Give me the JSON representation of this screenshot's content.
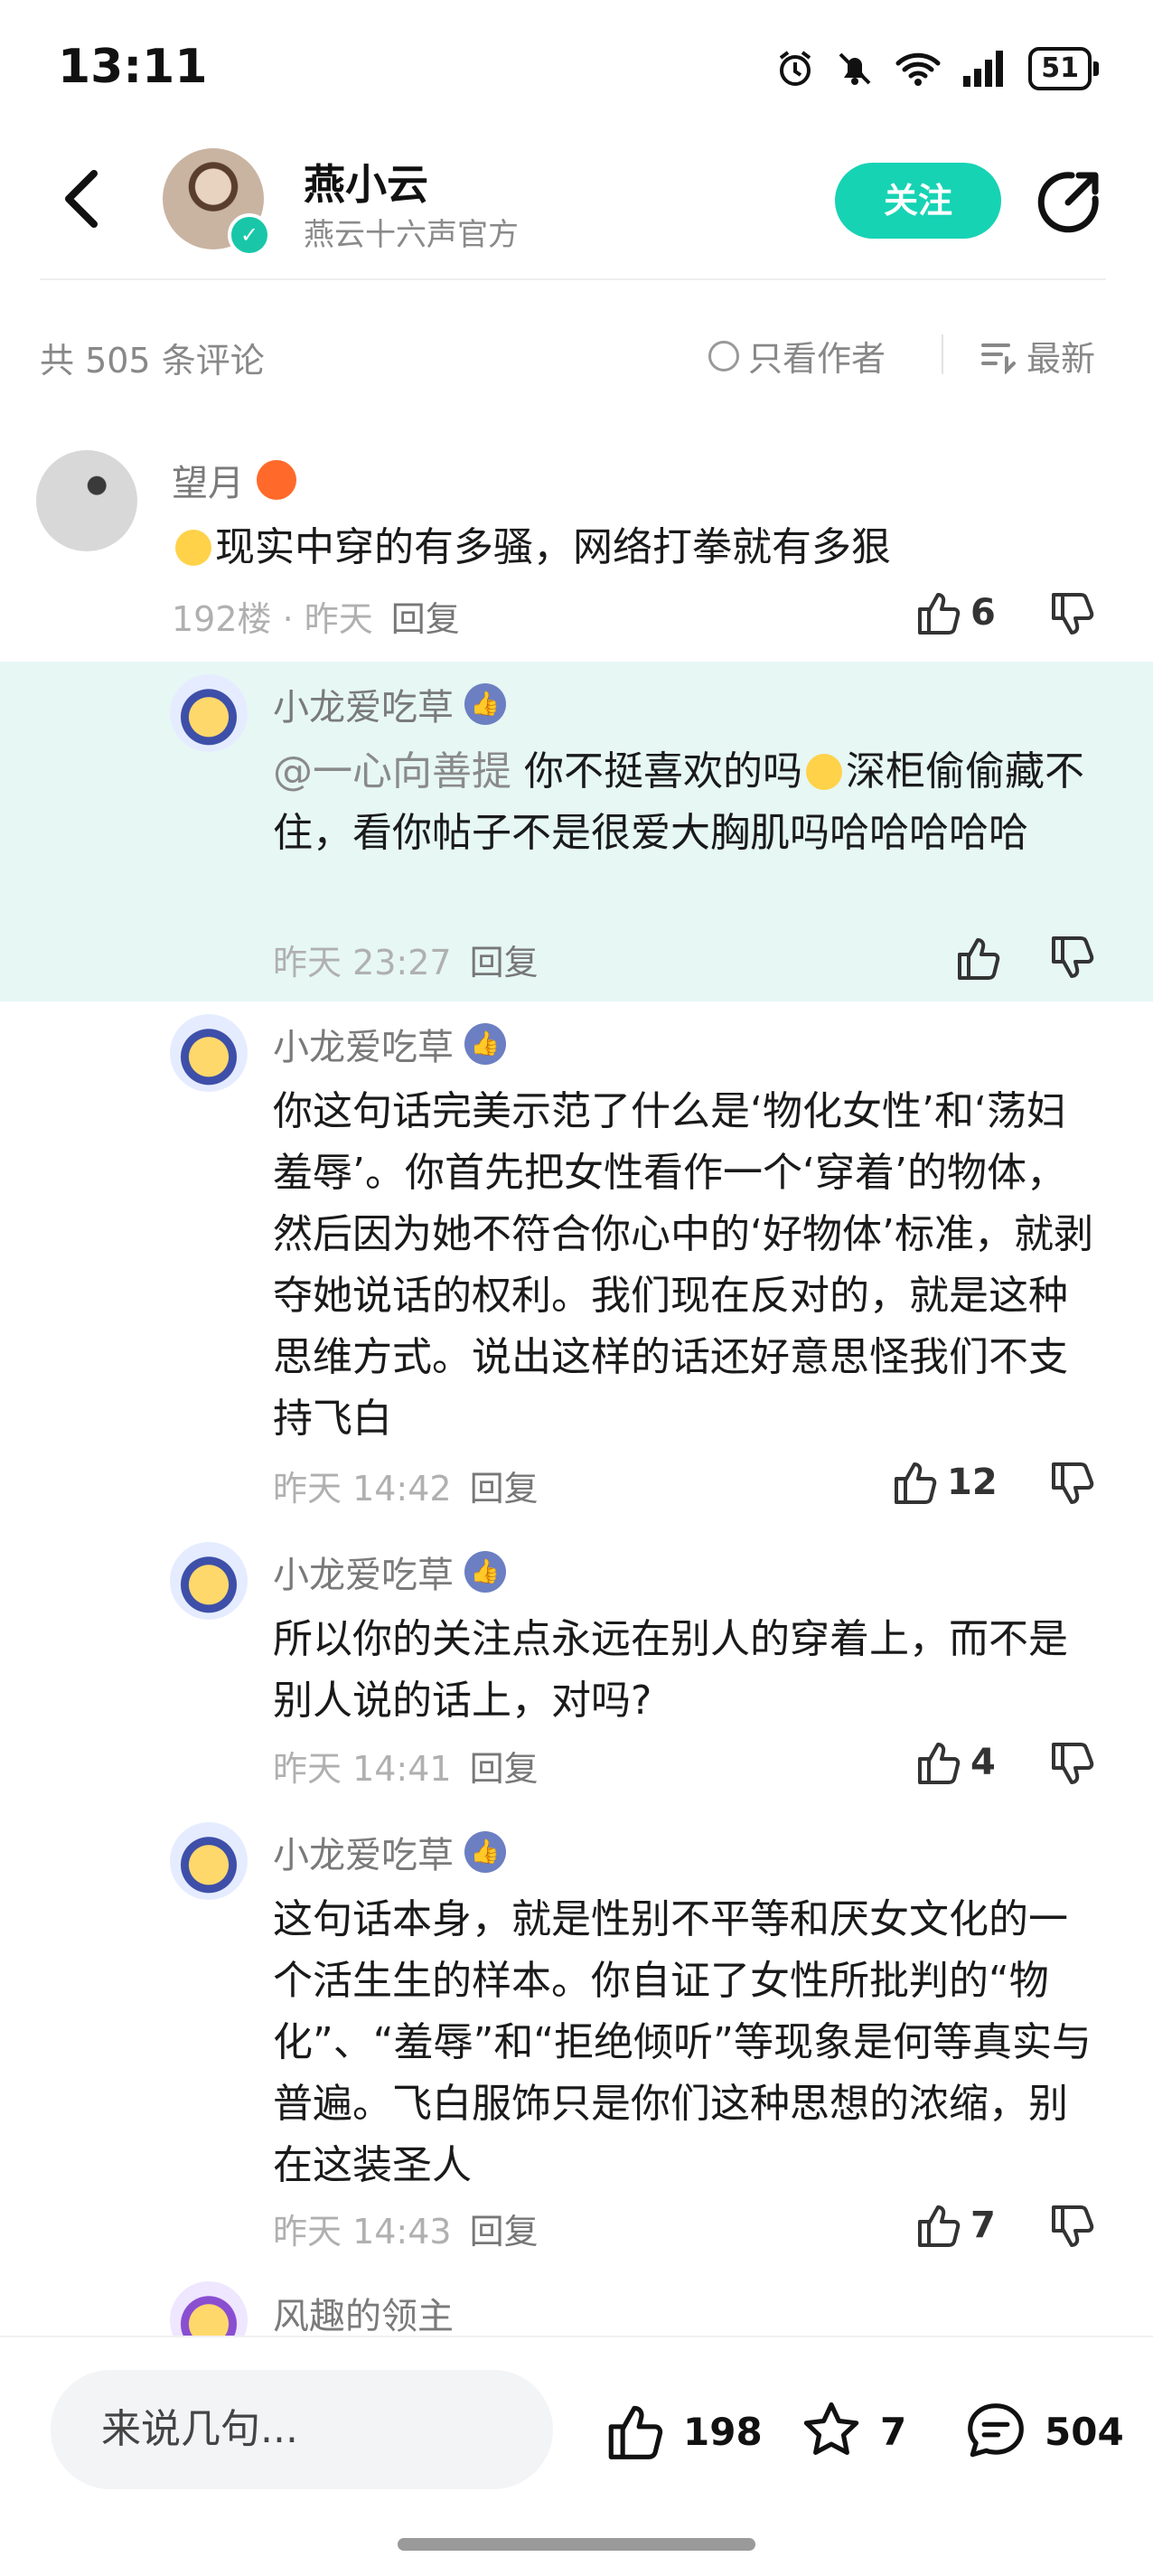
{
  "status_bar": {
    "time": "13:11",
    "battery": "51"
  },
  "header": {
    "author_name": "燕小云",
    "author_sub": "燕云十六声官方",
    "follow_label": "关注"
  },
  "comments_header": {
    "total": "共 505 条评论",
    "only_author": "只看作者",
    "sort": "最新"
  },
  "comments": [
    {
      "user": "望月",
      "text": "现实中穿的有多骚，网络打拳就有多狠",
      "floor": "192楼 · 昨天",
      "reply": "回复",
      "likes": "6"
    },
    {
      "user": "小龙爱吃草",
      "mention": "@一心向善提",
      "text_a": " 你不挺喜欢的吗",
      "text_b": "深柜偷偷藏不住，看你帖子不是很爱大胸肌吗哈哈哈哈哈",
      "time": "昨天 23:27",
      "reply": "回复"
    },
    {
      "user": "小龙爱吃草",
      "text": "你这句话完美示范了什么是‘物化女性’和‘荡妇羞辱’。你首先把女性看作一个‘穿着’的物体，然后因为她不符合你心中的‘好物体’标准，就剥夺她说话的权利。我们现在反对的，就是这种思维方式。说出这样的话还好意思怪我们不支持飞白",
      "time": "昨天 14:42",
      "reply": "回复",
      "likes": "12"
    },
    {
      "user": "小龙爱吃草",
      "text": "所以你的关注点永远在别人的穿着上，而不是别人说的话上，对吗?",
      "time": "昨天 14:41",
      "reply": "回复",
      "likes": "4"
    },
    {
      "user": "小龙爱吃草",
      "text": "这句话本身，就是性别不平等和厌女文化的一个活生生的样本。你自证了女性所批判的“物化”、“羞辱”和“拒绝倾听”等现象是何等真实与普遍。飞白服饰只是你们这种思想的浓缩，别在这装圣人",
      "time": "昨天 14:43",
      "reply": "回复",
      "likes": "7"
    },
    {
      "user": "风趣的领主"
    }
  ],
  "bottom_bar": {
    "input_placeholder": "来说几句...",
    "likes": "198",
    "favorites": "7",
    "comments": "504"
  },
  "colors": {
    "accent": "#16d3b4",
    "highlight": "#e6f7f4"
  }
}
